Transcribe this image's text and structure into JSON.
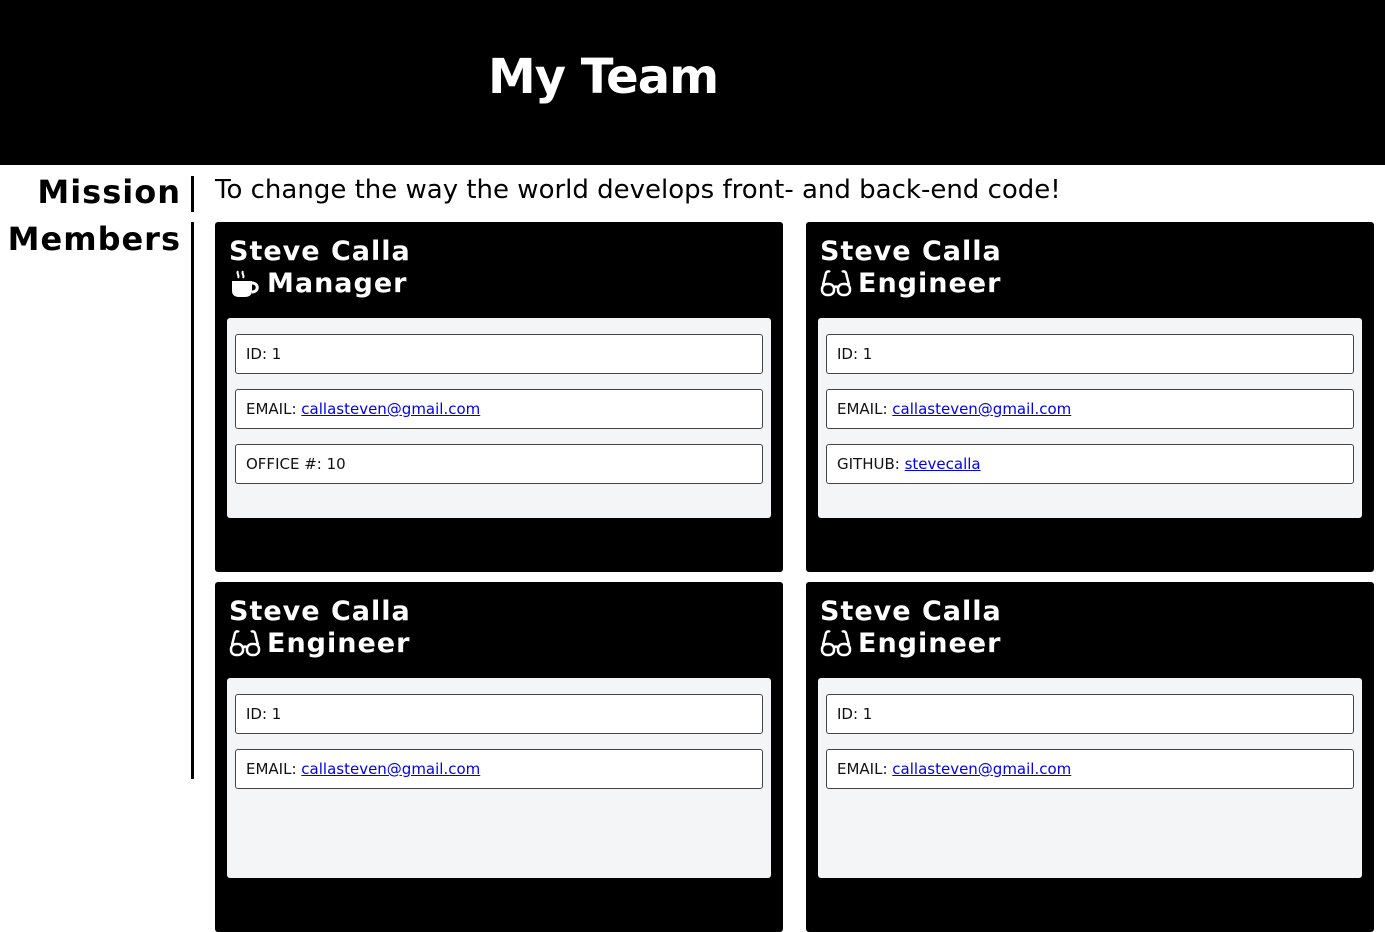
{
  "header": {
    "title": "My Team"
  },
  "mission": {
    "label": "Mission",
    "text": "To change the way the world develops front- and back-end code!"
  },
  "members": {
    "label": "Members",
    "cards": [
      {
        "name": "Steve Calla",
        "role": "Manager",
        "icon": "coffee-icon",
        "id_label": "ID: ",
        "id": "1",
        "email_label": "EMAIL: ",
        "email": "callasteven@gmail.com",
        "extra_label": "OFFICE #: ",
        "extra_value": "10"
      },
      {
        "name": "Steve Calla",
        "role": "Engineer",
        "icon": "glasses-icon",
        "id_label": "ID: ",
        "id": "1",
        "email_label": "EMAIL: ",
        "email": "callasteven@gmail.com",
        "extra_label": "GITHUB: ",
        "extra_value": "stevecalla"
      },
      {
        "name": "Steve Calla",
        "role": "Engineer",
        "icon": "glasses-icon",
        "id_label": "ID: ",
        "id": "1",
        "email_label": "EMAIL: ",
        "email": "callasteven@gmail.com"
      },
      {
        "name": "Steve Calla",
        "role": "Engineer",
        "icon": "glasses-icon",
        "id_label": "ID: ",
        "id": "1",
        "email_label": "EMAIL: ",
        "email": "callasteven@gmail.com"
      }
    ]
  },
  "colors": {
    "header_bg": "#000000",
    "card_bg": "#000000",
    "card_body_bg": "#f4f5f6",
    "link": "#0000ee"
  }
}
